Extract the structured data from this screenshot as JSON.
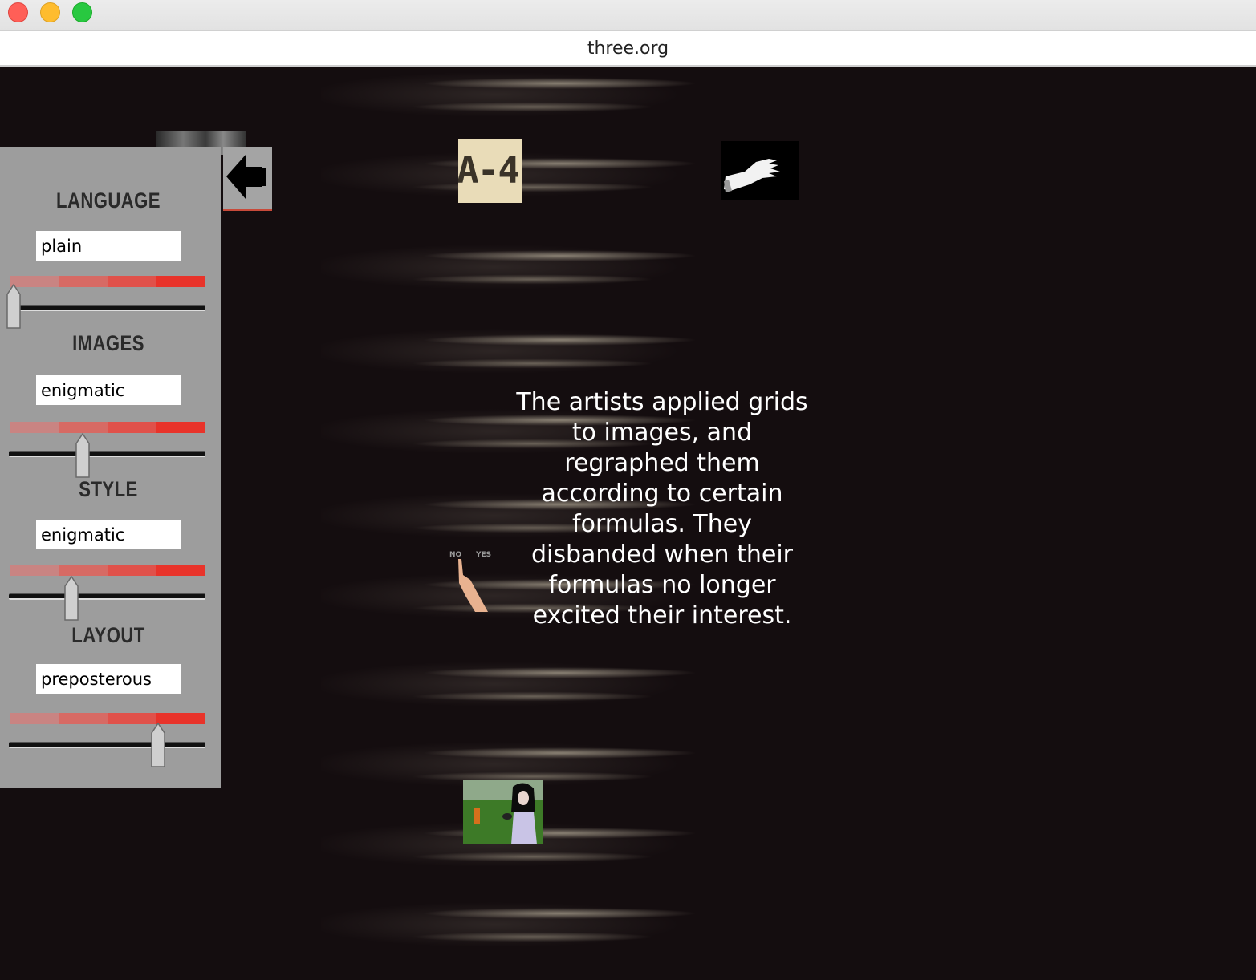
{
  "window": {
    "url": "three.org"
  },
  "controls": [
    {
      "title": "LANGUAGE",
      "value": "plain",
      "slider": 0.03
    },
    {
      "title": "IMAGES",
      "value": "enigmatic",
      "slider": 0.37
    },
    {
      "title": "STYLE",
      "value": "enigmatic",
      "slider": 0.32
    },
    {
      "title": "LAYOUT",
      "value": "preposterous",
      "slider": 0.77
    }
  ],
  "main": {
    "message": "The artists applied grids to images, and regraphed them according to certain formulas. They disbanded when their formulas no longer excited their interest.",
    "thumb_text_a4": "A-4",
    "finger_label_no": "NO",
    "finger_label_yes": "YES"
  },
  "colors": {
    "panel": "#9d9d9d",
    "stage": "#140d0f",
    "accent_red": "#e8332a"
  },
  "icons": {
    "back": "arrow-left-icon"
  }
}
